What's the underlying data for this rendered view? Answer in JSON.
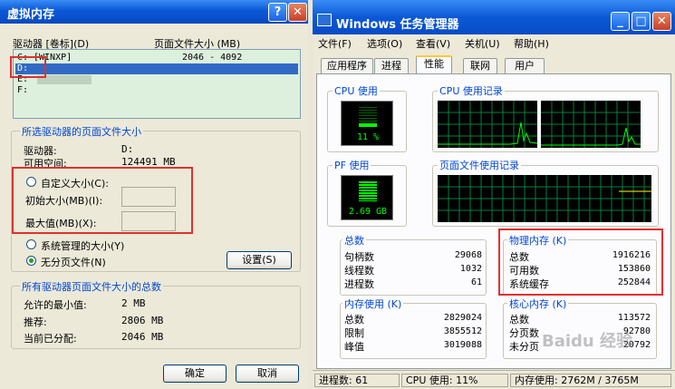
{
  "vm": {
    "title": "虚拟内存",
    "help_btn": "?",
    "close_btn": "✕",
    "col_drive": "驱动器 [卷标](D)",
    "col_pagesize": "页面文件大小 (MB)",
    "drives": [
      {
        "drive": "C:",
        "label": "[WINXP]",
        "size": "2046 - 4092"
      },
      {
        "drive": "D:",
        "label": "",
        "size": ""
      },
      {
        "drive": "E:",
        "label": "",
        "size": ""
      },
      {
        "drive": "F:",
        "label": "",
        "size": ""
      }
    ],
    "selected_group": {
      "title": "所选驱动器的页面文件大小",
      "drive_label": "驱动器:",
      "drive_value": "D:",
      "free_label": "可用空间:",
      "free_value": "124491 MB",
      "custom_label": "自定义大小(C):",
      "initial_label": "初始大小(MB)(I):",
      "max_label": "最大值(MB)(X):",
      "system_label": "系统管理的大小(Y)",
      "none_label": "无分页文件(N)",
      "set_button": "设置(S)"
    },
    "total_group": {
      "title": "所有驱动器页面文件大小的总数",
      "min_label": "允许的最小值:",
      "min_value": "2 MB",
      "rec_label": "推荐:",
      "rec_value": "2806 MB",
      "cur_label": "当前已分配:",
      "cur_value": "2046 MB"
    },
    "ok_button": "确定",
    "cancel_button": "取消"
  },
  "tm": {
    "title": "Windows 任务管理器",
    "window_buttons": [
      "_",
      "□",
      "✕"
    ],
    "menu": [
      "文件(F)",
      "选项(O)",
      "查看(V)",
      "关机(U)",
      "帮助(H)"
    ],
    "tabs": [
      "应用程序",
      "进程",
      "性能",
      "联网",
      "用户"
    ],
    "active_tab": "性能",
    "cpu_usage_title": "CPU 使用",
    "cpu_usage_value": "11 %",
    "cpu_history_title": "CPU 使用记录",
    "pf_usage_title": "PF 使用",
    "pf_usage_value": "2.69 GB",
    "pf_history_title": "页面文件使用记录",
    "totals": {
      "title": "总数",
      "rows": [
        {
          "label": "句柄数",
          "value": "29068"
        },
        {
          "label": "线程数",
          "value": "1032"
        },
        {
          "label": "进程数",
          "value": "61"
        }
      ]
    },
    "physical": {
      "title": "物理内存 (K)",
      "rows": [
        {
          "label": "总数",
          "value": "1916216"
        },
        {
          "label": "可用数",
          "value": "153860"
        },
        {
          "label": "系统缓存",
          "value": "252844"
        }
      ]
    },
    "commit": {
      "title": "内存使用 (K)",
      "rows": [
        {
          "label": "总数",
          "value": "2829024"
        },
        {
          "label": "限制",
          "value": "3855512"
        },
        {
          "label": "峰值",
          "value": "3019088"
        }
      ]
    },
    "kernel": {
      "title": "核心内存 (K)",
      "rows": [
        {
          "label": "总数",
          "value": "113572"
        },
        {
          "label": "分页数",
          "value": "92780"
        },
        {
          "label": "未分页",
          "value": "20792"
        }
      ]
    },
    "status": {
      "processes": "进程数: 61",
      "cpu": "CPU 使用: 11%",
      "memory": "内存使用: 2762M / 3765M"
    },
    "watermark": "Baidu 经验"
  },
  "colors": {
    "title_blue": "#0a58d6",
    "graph_green": "#00ff00",
    "grid_green": "#008040",
    "highlight_red": "#e03030",
    "group_title_blue": "#0046d5"
  }
}
